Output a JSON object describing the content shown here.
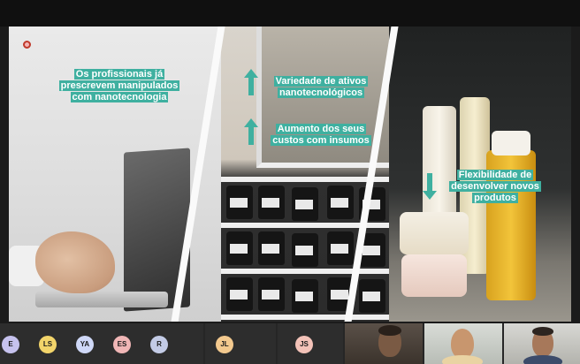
{
  "slide": {
    "caption_left": [
      "Os profissionais já",
      "prescrevem manipulados",
      "com nanotecnologia"
    ],
    "caption_variety": [
      "Variedade de ativos",
      "nanotecnológicos"
    ],
    "caption_costs": [
      "Aumento dos seus",
      "custos com insumos"
    ],
    "caption_flex": [
      "Flexibilidade de",
      "desenvolver novos",
      "produtos"
    ],
    "accent_color": "#3fb0a0",
    "arrow_up_icon": "arrow-up-icon",
    "arrow_down_icon": "arrow-down-icon"
  },
  "participants": [
    {
      "initials": "E",
      "color": "#c6c2ee"
    },
    {
      "initials": "LS",
      "color": "#f2d46a"
    },
    {
      "initials": "YA",
      "color": "#cfd8f7"
    },
    {
      "initials": "ES",
      "color": "#f0b6b6"
    },
    {
      "initials": "R",
      "color": "#c3cbe6"
    },
    {
      "initials": "JL",
      "color": "#f3c98e"
    },
    {
      "initials": "JS",
      "color": "#f3c2b8"
    }
  ]
}
